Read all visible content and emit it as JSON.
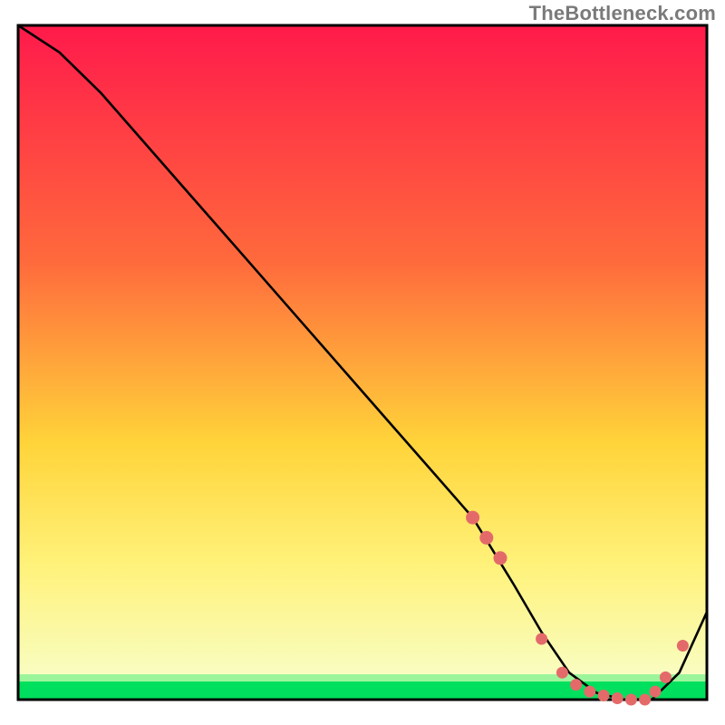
{
  "watermark": {
    "text": "TheBottleneck.com"
  },
  "colors": {
    "gradient_top": "#ff1a4b",
    "gradient_mid1": "#ff6a3c",
    "gradient_mid2": "#ffd43a",
    "gradient_mid3": "#fff27a",
    "gradient_bottom": "#00e05e",
    "frame": "#000000",
    "curve": "#000000",
    "dots": "#e46a6a"
  },
  "chart_data": {
    "type": "line",
    "title": "",
    "xlabel": "",
    "ylabel": "",
    "xlim": [
      0,
      100
    ],
    "ylim": [
      0,
      100
    ],
    "grid": false,
    "legend": false,
    "series": [
      {
        "name": "curve",
        "x": [
          0,
          6,
          12,
          18,
          24,
          30,
          36,
          42,
          48,
          54,
          60,
          66,
          72,
          76,
          80,
          84,
          88,
          92,
          96,
          100
        ],
        "y": [
          100,
          96,
          90,
          83,
          76,
          69,
          62,
          55,
          48,
          41,
          34,
          27,
          17,
          10,
          4,
          1,
          0,
          0,
          4,
          13
        ]
      }
    ],
    "dots": {
      "name": "highlight-points",
      "x": [
        66,
        68,
        70,
        76,
        79,
        81,
        83,
        85,
        87,
        89,
        91,
        92.5,
        94,
        96.5
      ],
      "y": [
        27,
        24,
        21,
        9,
        4,
        2.2,
        1.2,
        0.6,
        0.2,
        0.0,
        0.0,
        1.2,
        3.3,
        8.0
      ]
    },
    "green_band": {
      "y_start": 0,
      "y_end": 2.8
    },
    "annotations": []
  }
}
